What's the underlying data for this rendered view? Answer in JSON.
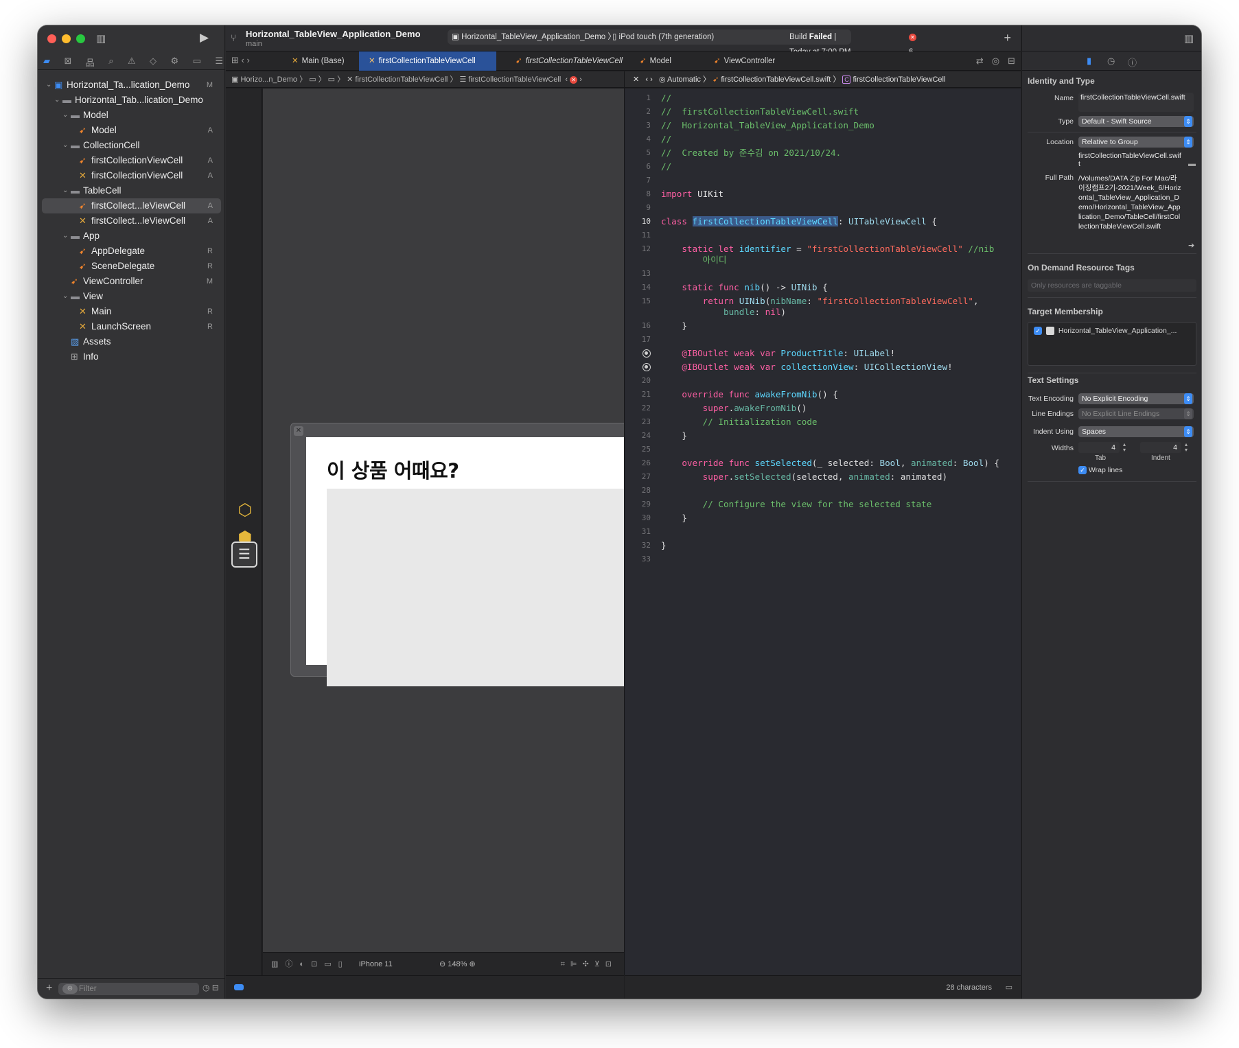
{
  "navigator": {
    "filter_placeholder": "Filter",
    "tree": [
      {
        "label": "Horizontal_Ta...lication_Demo",
        "badge": "M",
        "icon": "project-icon",
        "depth": 0,
        "chev": "⌄"
      },
      {
        "label": "Horizontal_Tab...lication_Demo",
        "badge": "",
        "icon": "folder-icon",
        "depth": 1,
        "chev": "⌄"
      },
      {
        "label": "Model",
        "badge": "",
        "icon": "folder-icon",
        "depth": 2,
        "chev": "⌄"
      },
      {
        "label": "Model",
        "badge": "A",
        "icon": "swift-file-icon",
        "depth": 3,
        "chev": ""
      },
      {
        "label": "CollectionCell",
        "badge": "",
        "icon": "folder-icon",
        "depth": 2,
        "chev": "⌄"
      },
      {
        "label": "firstCollectionViewCell",
        "badge": "A",
        "icon": "swift-file-icon",
        "depth": 3,
        "chev": ""
      },
      {
        "label": "firstCollectionViewCell",
        "badge": "A",
        "icon": "xib-file-icon",
        "depth": 3,
        "chev": ""
      },
      {
        "label": "TableCell",
        "badge": "",
        "icon": "folder-icon",
        "depth": 2,
        "chev": "⌄"
      },
      {
        "label": "firstCollect...leViewCell",
        "badge": "A",
        "icon": "swift-file-icon",
        "depth": 3,
        "chev": "",
        "selected": true
      },
      {
        "label": "firstCollect...leViewCell",
        "badge": "A",
        "icon": "xib-file-icon",
        "depth": 3,
        "chev": ""
      },
      {
        "label": "App",
        "badge": "",
        "icon": "folder-icon",
        "depth": 2,
        "chev": "⌄"
      },
      {
        "label": "AppDelegate",
        "badge": "R",
        "icon": "swift-file-icon",
        "depth": 3,
        "chev": ""
      },
      {
        "label": "SceneDelegate",
        "badge": "R",
        "icon": "swift-file-icon",
        "depth": 3,
        "chev": ""
      },
      {
        "label": "ViewController",
        "badge": "M",
        "icon": "swift-file-icon",
        "depth": 2,
        "chev": ""
      },
      {
        "label": "View",
        "badge": "",
        "icon": "folder-icon",
        "depth": 2,
        "chev": "⌄"
      },
      {
        "label": "Main",
        "badge": "R",
        "icon": "xib-file-icon",
        "depth": 3,
        "chev": ""
      },
      {
        "label": "LaunchScreen",
        "badge": "R",
        "icon": "xib-file-icon",
        "depth": 3,
        "chev": ""
      },
      {
        "label": "Assets",
        "badge": "",
        "icon": "assets-icon",
        "depth": 2,
        "chev": ""
      },
      {
        "label": "Info",
        "badge": "",
        "icon": "info-plist-icon",
        "depth": 2,
        "chev": ""
      }
    ]
  },
  "toolbar": {
    "project_title": "Horizontal_TableView_Application_Demo",
    "branch": "main",
    "scheme": "Horizontal_TableView_Application_Demo",
    "device": "iPod touch (7th generation)",
    "status_prefix": "Build",
    "status_strong": "Failed",
    "status_suffix": "| Today at 7:00 PM",
    "error_count": "6"
  },
  "tabs": [
    {
      "label": "Main (Base)",
      "icon": "xib-file-icon",
      "active": false,
      "italic": false
    },
    {
      "label": "firstCollectionTableViewCell",
      "icon": "xib-file-icon",
      "active": true,
      "italic": false
    },
    {
      "label": "firstCollectionTableViewCell",
      "icon": "swift-file-icon",
      "active": false,
      "italic": true
    },
    {
      "label": "Model",
      "icon": "swift-file-icon",
      "active": false,
      "italic": false
    },
    {
      "label": "ViewController",
      "icon": "swift-file-icon",
      "active": false,
      "italic": false
    }
  ],
  "ib": {
    "jump_bar": [
      "Horizo...n_Demo",
      "firstCollectionTableViewCell",
      "firstCollectionTableViewCell"
    ],
    "cell_title": "이 상품 어때요?",
    "device": "iPhone 11",
    "zoom": "148%"
  },
  "editor": {
    "jump_bar": [
      "Automatic",
      "firstCollectionTableViewCell.swift",
      "firstCollectionTableViewCell"
    ],
    "status": "28 characters",
    "current_line": "10",
    "lines": [
      {
        "n": "1",
        "tokens": [
          [
            "cm",
            "//"
          ]
        ]
      },
      {
        "n": "2",
        "tokens": [
          [
            "cm",
            "//  firstCollectionTableViewCell.swift"
          ]
        ]
      },
      {
        "n": "3",
        "tokens": [
          [
            "cm",
            "//  Horizontal_TableView_Application_Demo"
          ]
        ]
      },
      {
        "n": "4",
        "tokens": [
          [
            "cm",
            "//"
          ]
        ]
      },
      {
        "n": "5",
        "tokens": [
          [
            "cm",
            "//  Created by 준수김 on 2021/10/24."
          ]
        ]
      },
      {
        "n": "6",
        "tokens": [
          [
            "cm",
            "//"
          ]
        ]
      },
      {
        "n": "7",
        "tokens": []
      },
      {
        "n": "8",
        "tokens": [
          [
            "kw",
            "import"
          ],
          [
            "plain",
            " UIKit"
          ]
        ]
      },
      {
        "n": "9",
        "tokens": []
      },
      {
        "n": "10",
        "tokens": [
          [
            "kw",
            "class"
          ],
          [
            "plain",
            " "
          ],
          [
            "hl",
            "firstCollectionTableViewCell"
          ],
          [
            "plain",
            ": "
          ],
          [
            "tyn",
            "UITableViewCell"
          ],
          [
            "plain",
            " {"
          ]
        ]
      },
      {
        "n": "11",
        "tokens": []
      },
      {
        "n": "12",
        "tokens": [
          [
            "plain",
            "    "
          ],
          [
            "kw",
            "static let"
          ],
          [
            "plain",
            " "
          ],
          [
            "ty",
            "identifier"
          ],
          [
            "plain",
            " = "
          ],
          [
            "str",
            "\"firstCollectionTableViewCell\""
          ],
          [
            "plain",
            " "
          ],
          [
            "cm",
            "//nib"
          ]
        ]
      },
      {
        "n": "",
        "tokens": [
          [
            "plain",
            "        "
          ],
          [
            "cm",
            "아이디"
          ]
        ]
      },
      {
        "n": "13",
        "tokens": []
      },
      {
        "n": "14",
        "tokens": [
          [
            "plain",
            "    "
          ],
          [
            "kw",
            "static func"
          ],
          [
            "plain",
            " "
          ],
          [
            "ty",
            "nib"
          ],
          [
            "plain",
            "() -> "
          ],
          [
            "tyn",
            "UINib"
          ],
          [
            "plain",
            " {"
          ]
        ]
      },
      {
        "n": "15",
        "tokens": [
          [
            "plain",
            "        "
          ],
          [
            "kw",
            "return"
          ],
          [
            "plain",
            " "
          ],
          [
            "tyn",
            "UINib"
          ],
          [
            "plain",
            "("
          ],
          [
            "id",
            "nibName"
          ],
          [
            "plain",
            ": "
          ],
          [
            "str",
            "\"firstCollectionTableViewCell\""
          ],
          [
            "plain",
            ","
          ]
        ]
      },
      {
        "n": "",
        "tokens": [
          [
            "plain",
            "            "
          ],
          [
            "id",
            "bundle"
          ],
          [
            "plain",
            ": "
          ],
          [
            "kw",
            "nil"
          ],
          [
            "plain",
            ")"
          ]
        ]
      },
      {
        "n": "16",
        "tokens": [
          [
            "plain",
            "    }"
          ]
        ]
      },
      {
        "n": "17",
        "tokens": []
      },
      {
        "n": "18",
        "outlet": true,
        "tokens": [
          [
            "plain",
            "    "
          ],
          [
            "kw",
            "@IBOutlet weak var"
          ],
          [
            "plain",
            " "
          ],
          [
            "ty",
            "ProductTitle"
          ],
          [
            "plain",
            ": "
          ],
          [
            "tyn",
            "UILabel"
          ],
          [
            "plain",
            "!"
          ]
        ]
      },
      {
        "n": "19",
        "outlet": true,
        "tokens": [
          [
            "plain",
            "    "
          ],
          [
            "kw",
            "@IBOutlet weak var"
          ],
          [
            "plain",
            " "
          ],
          [
            "ty",
            "collectionView"
          ],
          [
            "plain",
            ": "
          ],
          [
            "tyn",
            "UICollectionView"
          ],
          [
            "plain",
            "!"
          ]
        ]
      },
      {
        "n": "20",
        "tokens": []
      },
      {
        "n": "21",
        "tokens": [
          [
            "plain",
            "    "
          ],
          [
            "kw",
            "override func"
          ],
          [
            "plain",
            " "
          ],
          [
            "ty",
            "awakeFromNib"
          ],
          [
            "plain",
            "() {"
          ]
        ]
      },
      {
        "n": "22",
        "tokens": [
          [
            "plain",
            "        "
          ],
          [
            "kw",
            "super"
          ],
          [
            "plain",
            "."
          ],
          [
            "id",
            "awakeFromNib"
          ],
          [
            "plain",
            "()"
          ]
        ]
      },
      {
        "n": "23",
        "tokens": [
          [
            "plain",
            "        "
          ],
          [
            "cm",
            "// Initialization code"
          ]
        ]
      },
      {
        "n": "24",
        "tokens": [
          [
            "plain",
            "    }"
          ]
        ]
      },
      {
        "n": "25",
        "tokens": []
      },
      {
        "n": "26",
        "tokens": [
          [
            "plain",
            "    "
          ],
          [
            "kw",
            "override func"
          ],
          [
            "plain",
            " "
          ],
          [
            "ty",
            "setSelected"
          ],
          [
            "plain",
            "(_ selected: "
          ],
          [
            "tyn",
            "Bool"
          ],
          [
            "plain",
            ", "
          ],
          [
            "id",
            "animated"
          ],
          [
            "plain",
            ": "
          ],
          [
            "tyn",
            "Bool"
          ],
          [
            "plain",
            ") {"
          ]
        ]
      },
      {
        "n": "27",
        "tokens": [
          [
            "plain",
            "        "
          ],
          [
            "kw",
            "super"
          ],
          [
            "plain",
            "."
          ],
          [
            "id",
            "setSelected"
          ],
          [
            "plain",
            "(selected, "
          ],
          [
            "id",
            "animated"
          ],
          [
            "plain",
            ": animated)"
          ]
        ]
      },
      {
        "n": "28",
        "tokens": []
      },
      {
        "n": "29",
        "tokens": [
          [
            "plain",
            "        "
          ],
          [
            "cm",
            "// Configure the view for the selected state"
          ]
        ]
      },
      {
        "n": "30",
        "tokens": [
          [
            "plain",
            "    }"
          ]
        ]
      },
      {
        "n": "31",
        "tokens": []
      },
      {
        "n": "32",
        "tokens": [
          [
            "plain",
            "}"
          ]
        ]
      },
      {
        "n": "33",
        "tokens": []
      }
    ]
  },
  "inspector": {
    "identity_head": "Identity and Type",
    "name_label": "Name",
    "name_value": "firstCollectionTableViewCell.swift",
    "type_label": "Type",
    "type_value": "Default - Swift Source",
    "location_label": "Location",
    "location_value": "Relative to Group",
    "location_file": "firstCollectionTableViewCell.swift",
    "fullpath_label": "Full Path",
    "fullpath_value": "/Volumes/DATA Zip For Mac/라이징캠프2기-2021/Week_6/Horizontal_TableView_Application_Demo/Horizontal_TableView_Application_Demo/TableCell/firstCollectionTableViewCell.swift",
    "odr_head": "On Demand Resource Tags",
    "odr_placeholder": "Only resources are taggable",
    "target_head": "Target Membership",
    "target_name": "Horizontal_TableView_Application_...",
    "text_head": "Text Settings",
    "encoding_label": "Text Encoding",
    "encoding_value": "No Explicit Encoding",
    "endings_label": "Line Endings",
    "endings_value": "No Explicit Line Endings",
    "indent_label": "Indent Using",
    "indent_value": "Spaces",
    "widths_label": "Widths",
    "tab_width": "4",
    "indent_width": "4",
    "tab_sub": "Tab",
    "indent_sub": "Indent",
    "wrap_label": "Wrap lines"
  },
  "colors": {
    "accent": "#3d8cf4",
    "active_tab": "#2a5299",
    "error": "#e84a3f",
    "swift_icon": "#f0842c",
    "editor_bg": "#292a30"
  }
}
